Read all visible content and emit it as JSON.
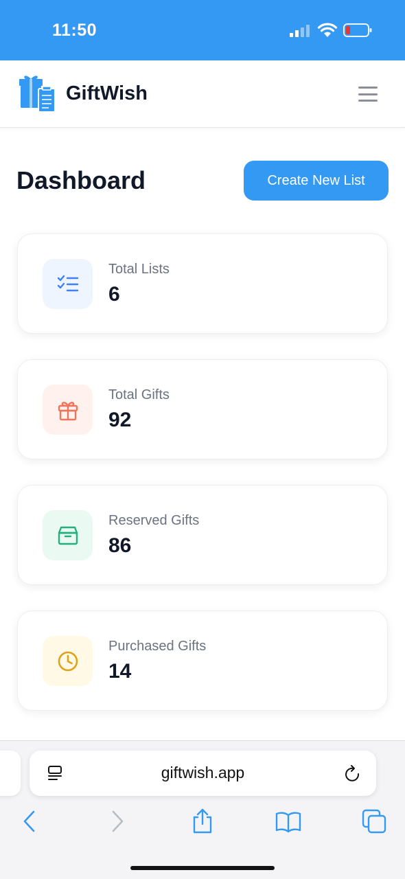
{
  "status_bar": {
    "time": "11:50"
  },
  "header": {
    "brand": "GiftWish"
  },
  "page": {
    "title": "Dashboard",
    "create_button": "Create New List"
  },
  "stats": [
    {
      "label": "Total Lists",
      "value": "6",
      "icon": "checklist-icon",
      "color": "#3b82f6",
      "bg": "#eef5ff"
    },
    {
      "label": "Total Gifts",
      "value": "92",
      "icon": "gift-icon",
      "color": "#f0745a",
      "bg": "#fff1ee"
    },
    {
      "label": "Reserved Gifts",
      "value": "86",
      "icon": "box-icon",
      "color": "#22b07d",
      "bg": "#eafaf2"
    },
    {
      "label": "Purchased Gifts",
      "value": "14",
      "icon": "clock-icon",
      "color": "#e0a21b",
      "bg": "#fff9e6"
    }
  ],
  "browser": {
    "url": "giftwish.app"
  },
  "colors": {
    "primary": "#3399f3",
    "text_dark": "#111827",
    "text_muted": "#6b7280"
  }
}
